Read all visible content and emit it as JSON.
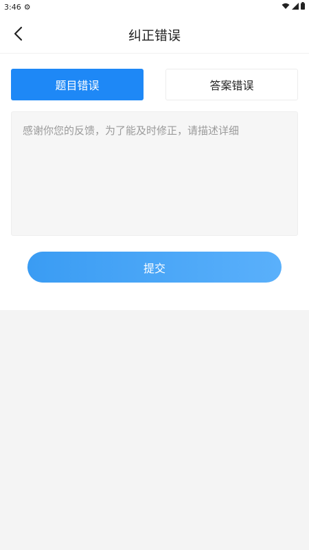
{
  "status_bar": {
    "time": "3:46",
    "settings_icon": "gear-icon",
    "wifi_icon": "wifi-icon",
    "signal_icon": "signal-icon",
    "battery_icon": "battery-icon"
  },
  "header": {
    "back_icon": "chevron-left-icon",
    "title": "纠正错误"
  },
  "tabs": [
    {
      "label": "题目错误",
      "active": true
    },
    {
      "label": "答案错误",
      "active": false
    }
  ],
  "feedback": {
    "placeholder": "感谢你您的反馈，为了能及时修正，请描述详细",
    "value": ""
  },
  "submit_label": "提交",
  "colors": {
    "accent": "#1e88f6",
    "button_gradient_start": "#3a9cf3",
    "button_gradient_end": "#5ab0fb",
    "page_bg": "#f4f4f4"
  }
}
